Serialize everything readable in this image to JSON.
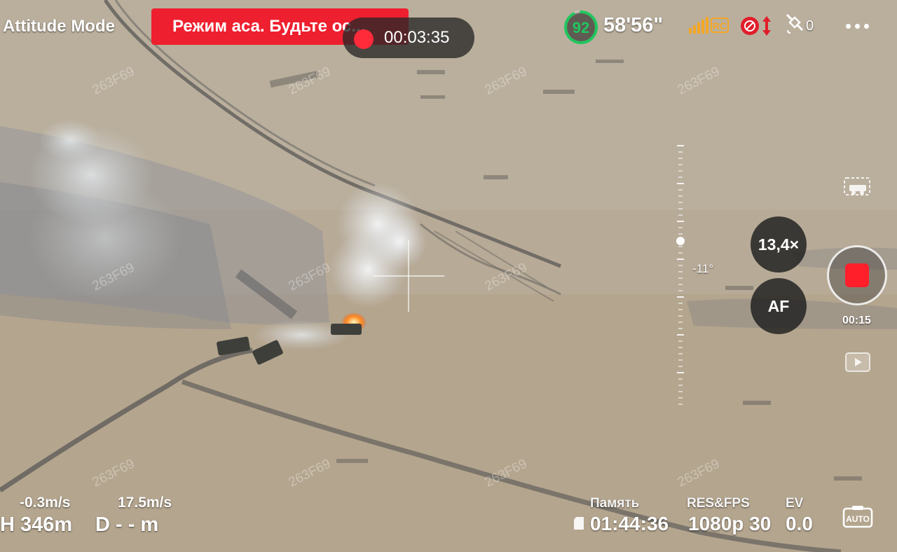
{
  "hud": {
    "flight_mode": "Attitude Mode",
    "banner_text": "Режим аса. Будьте ос...",
    "rec_time": "00:03:35",
    "battery_percent": "92",
    "battery_level": 0.92,
    "flight_time_left": "58'56\"",
    "rc_label": "RC",
    "satellites": "0",
    "gimbal_angle": "-11°",
    "zoom": "13,4×",
    "af": "AF",
    "recording_length": "00:15",
    "vertical_speed": "-0.3m/s",
    "horizontal_speed": "17.5m/s",
    "height": "H 346m",
    "distance": "D - - m",
    "memory_label": "Память",
    "memory_value": "01:44:36",
    "res_fps_label": "RES&FPS",
    "res_fps_value": "1080p 30",
    "ev_label": "EV",
    "ev_value": "0.0",
    "auto_label": "AUTO",
    "watermark": "263F69"
  },
  "colors": {
    "banner": "#ee1f2e",
    "record": "#ff1f2b",
    "battery_ring": "#22c55e",
    "signal": "#f5a623",
    "obstacle": "#e11d2a",
    "terrain": "#b8ab98"
  },
  "icons": [
    "battery-ring-icon",
    "signal-bars-icon",
    "obstacle-avoidance-icon",
    "gps-satellite-icon",
    "more-options-icon",
    "vehicle-detect-icon",
    "playback-icon",
    "sd-card-icon",
    "auto-camera-icon"
  ]
}
